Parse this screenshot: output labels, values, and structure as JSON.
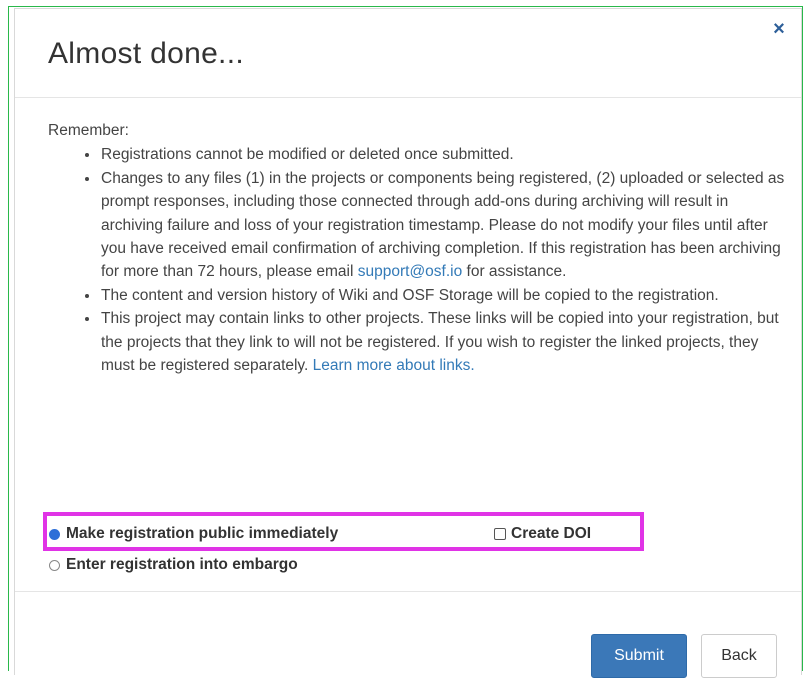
{
  "modal": {
    "title": "Almost done...",
    "close_glyph": "×",
    "close_icon": "close-icon",
    "intro": "Remember:",
    "bullets": {
      "b1": "Registrations cannot be modified or deleted once submitted.",
      "b2_text": "Changes to any files (1) in the projects or components being registered, (2) uploaded or selected as prompt responses, including those connected through add-ons during archiving will result in archiving failure and loss of your registration timestamp. Please do not modify your files until after you have received email confirmation of archiving completion. If this registration has been archiving for more than 72 hours, please email ",
      "b2_link": "support@osf.io",
      "b2_suffix": " for assistance.",
      "b3": "The content and version history of Wiki and OSF Storage will be copied to the registration.",
      "b4_text": "This project may contain links to other projects. These links will be copied into your registration, but the projects that they link to will not be registered. If you wish to register the linked projects, they must be registered separately. ",
      "b4_link": "Learn more about links."
    },
    "options": {
      "public_label": "Make registration public immediately",
      "public_checked": true,
      "doi_label": "Create DOI",
      "doi_checked": false,
      "embargo_label": "Enter registration into embargo",
      "embargo_checked": false
    },
    "footer": {
      "submit_label": "Submit",
      "back_label": "Back"
    },
    "colors": {
      "primary": "#3b78b8",
      "link": "#337ab7",
      "highlight": "#e033e6",
      "frame": "#29b84a"
    }
  }
}
